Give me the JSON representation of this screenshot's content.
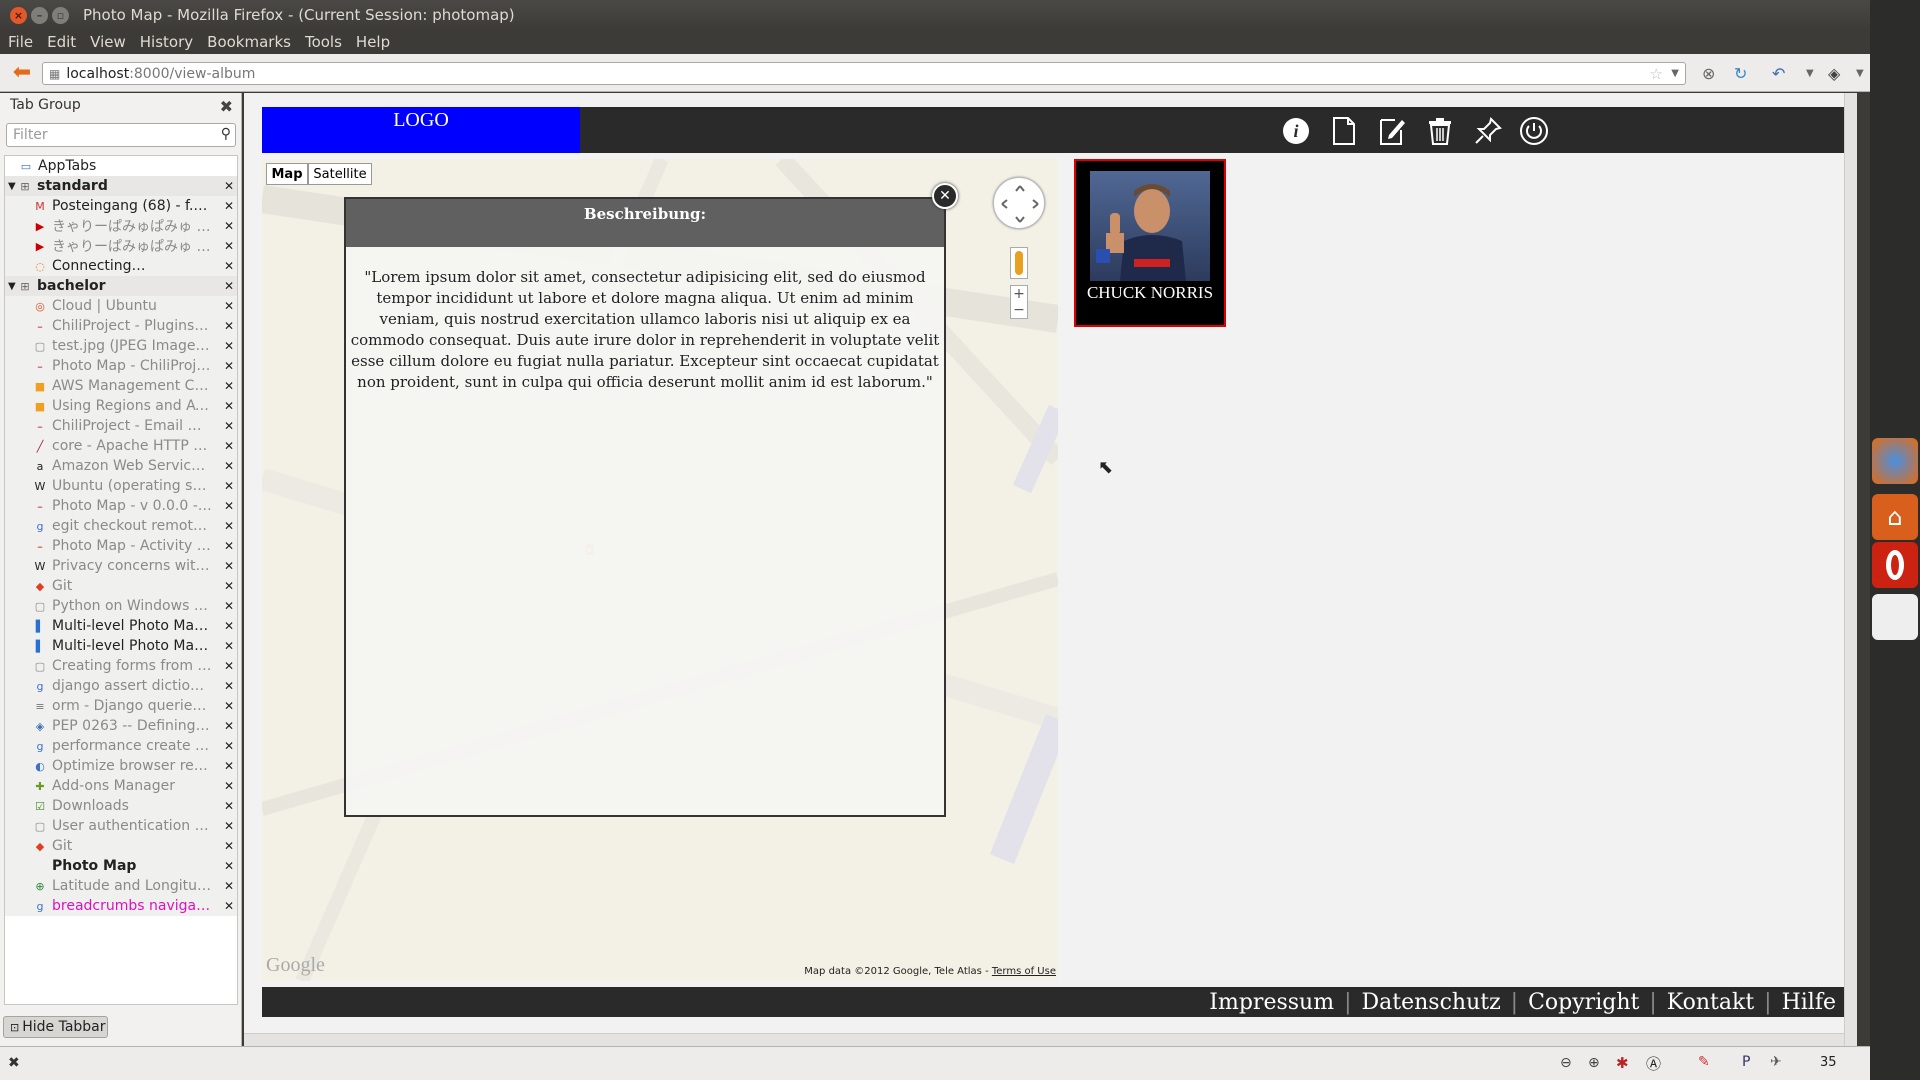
{
  "window": {
    "title": "Photo Map - Mozilla Firefox - (Current Session: photomap)"
  },
  "menu": [
    "File",
    "Edit",
    "View",
    "History",
    "Bookmarks",
    "Tools",
    "Help"
  ],
  "address": {
    "host": "localhost",
    "path": ":8000/view-album"
  },
  "sidebar": {
    "title": "Tab Group",
    "filter_placeholder": "Filter",
    "hide_label": "Hide Tabbar",
    "rows": [
      {
        "type": "apptabs",
        "label": "AppTabs",
        "icon": "window-icon"
      },
      {
        "type": "group",
        "label": "standard"
      },
      {
        "type": "tab",
        "label": "Posteingang (68) - f.v.…",
        "icon": "gmail-icon"
      },
      {
        "type": "tab",
        "label": "きゃりーぱみゅぱみゅ - …",
        "icon": "youtube-icon",
        "dim": true
      },
      {
        "type": "tab",
        "label": "きゃりーぱみゅぱみゅ - P…",
        "icon": "youtube-icon",
        "dim": true
      },
      {
        "type": "tab",
        "label": "Connecting…",
        "icon": "loading-icon"
      },
      {
        "type": "group",
        "label": "bachelor"
      },
      {
        "type": "tab",
        "label": "Cloud | Ubuntu",
        "icon": "ubuntu-icon",
        "dim": true
      },
      {
        "type": "tab",
        "label": "ChiliProject - Plugins - …",
        "icon": "chili-icon",
        "dim": true
      },
      {
        "type": "tab",
        "label": "test.jpg (JPEG Image, …",
        "icon": "page-icon",
        "dim": true
      },
      {
        "type": "tab",
        "label": "Photo Map - ChiliProject",
        "icon": "chili-icon",
        "dim": true
      },
      {
        "type": "tab",
        "label": "AWS Management Co…",
        "icon": "aws-icon",
        "dim": true
      },
      {
        "type": "tab",
        "label": "Using Regions and Av…",
        "icon": "aws-icon",
        "dim": true
      },
      {
        "type": "tab",
        "label": "ChiliProject - Email De…",
        "icon": "chili-icon",
        "dim": true
      },
      {
        "type": "tab",
        "label": "core - Apache HTTP Se…",
        "icon": "apache-icon",
        "dim": true
      },
      {
        "type": "tab",
        "label": "Amazon Web Services…",
        "icon": "amazon-icon",
        "dim": true
      },
      {
        "type": "tab",
        "label": "Ubuntu (operating sys…",
        "icon": "wikipedia-icon",
        "dim": true
      },
      {
        "type": "tab",
        "label": "Photo Map - v 0.0.0 - C…",
        "icon": "chili-icon",
        "dim": true
      },
      {
        "type": "tab",
        "label": "egit checkout remote …",
        "icon": "google-icon",
        "dim": true
      },
      {
        "type": "tab",
        "label": "Photo Map - Activity - …",
        "icon": "chili-icon",
        "dim": true
      },
      {
        "type": "tab",
        "label": "Privacy concerns with …",
        "icon": "wikipedia-icon",
        "dim": true
      },
      {
        "type": "tab",
        "label": "Git",
        "icon": "git-icon",
        "dim": true
      },
      {
        "type": "tab",
        "label": "Python on Windows F…",
        "icon": "page-icon",
        "dim": true
      },
      {
        "type": "tab",
        "label": "Multi-level Photo Map…",
        "icon": "stack-icon"
      },
      {
        "type": "tab",
        "label": "Multi-level Photo Map…",
        "icon": "stack-icon"
      },
      {
        "type": "tab",
        "label": "Creating forms from …",
        "icon": "page-icon",
        "dim": true
      },
      {
        "type": "tab",
        "label": "django assert diction…",
        "icon": "google-icon",
        "dim": true
      },
      {
        "type": "tab",
        "label": "orm - Django queries - …",
        "icon": "stackoverflow-icon",
        "dim": true
      },
      {
        "type": "tab",
        "label": "PEP 0263 -- Defining P…",
        "icon": "python-icon",
        "dim": true
      },
      {
        "type": "tab",
        "label": "performance create t…",
        "icon": "google-icon",
        "dim": true
      },
      {
        "type": "tab",
        "label": "Optimize browser ren…",
        "icon": "google-dev-icon",
        "dim": true
      },
      {
        "type": "tab",
        "label": "Add-ons Manager",
        "icon": "puzzle-icon",
        "dim": true
      },
      {
        "type": "tab",
        "label": "Downloads",
        "icon": "downloads-icon",
        "dim": true
      },
      {
        "type": "tab",
        "label": "User authentication in…",
        "icon": "page-icon",
        "dim": true
      },
      {
        "type": "tab",
        "label": "Git",
        "icon": "git-icon",
        "dim": true
      },
      {
        "type": "tab",
        "label": "Photo Map",
        "icon": "blank-icon",
        "bold": true
      },
      {
        "type": "tab",
        "label": "Latitude and Longitud…",
        "icon": "globe-icon",
        "dim": true
      },
      {
        "type": "tab",
        "label": "breadcrumbs navigati…",
        "icon": "google-icon",
        "pink": true
      }
    ]
  },
  "site": {
    "logo": "LOGO",
    "header_icons": [
      "info-icon",
      "new-page-icon",
      "edit-icon",
      "trash-icon",
      "pin-icon",
      "power-icon"
    ],
    "map": {
      "btn_map": "Map",
      "btn_satellite": "Satellite",
      "attribution": "Map data ©2012 Google, Tele Atlas - ",
      "terms": "Terms of Use",
      "google": "Google"
    },
    "modal": {
      "title": "Beschreibung:",
      "body": "\"Lorem ipsum dolor sit amet, consectetur adipisicing elit, sed do eiusmod tempor incididunt ut labore et dolore magna aliqua. Ut enim ad minim veniam, quis nostrud exercitation ullamco laboris nisi ut aliquip ex ea commodo consequat. Duis aute irure dolor in reprehenderit in voluptate velit esse cillum dolore eu fugiat nulla pariatur. Excepteur sint occaecat cupidatat non proident, sunt in culpa qui officia deserunt mollit anim id est laborum.\""
    },
    "photo_caption": "CHUCK NORRIS",
    "footer": [
      "Impressum",
      "Datenschutz",
      "Copyright",
      "Kontakt",
      "Hilfe"
    ]
  },
  "status": {
    "counter": "35"
  }
}
